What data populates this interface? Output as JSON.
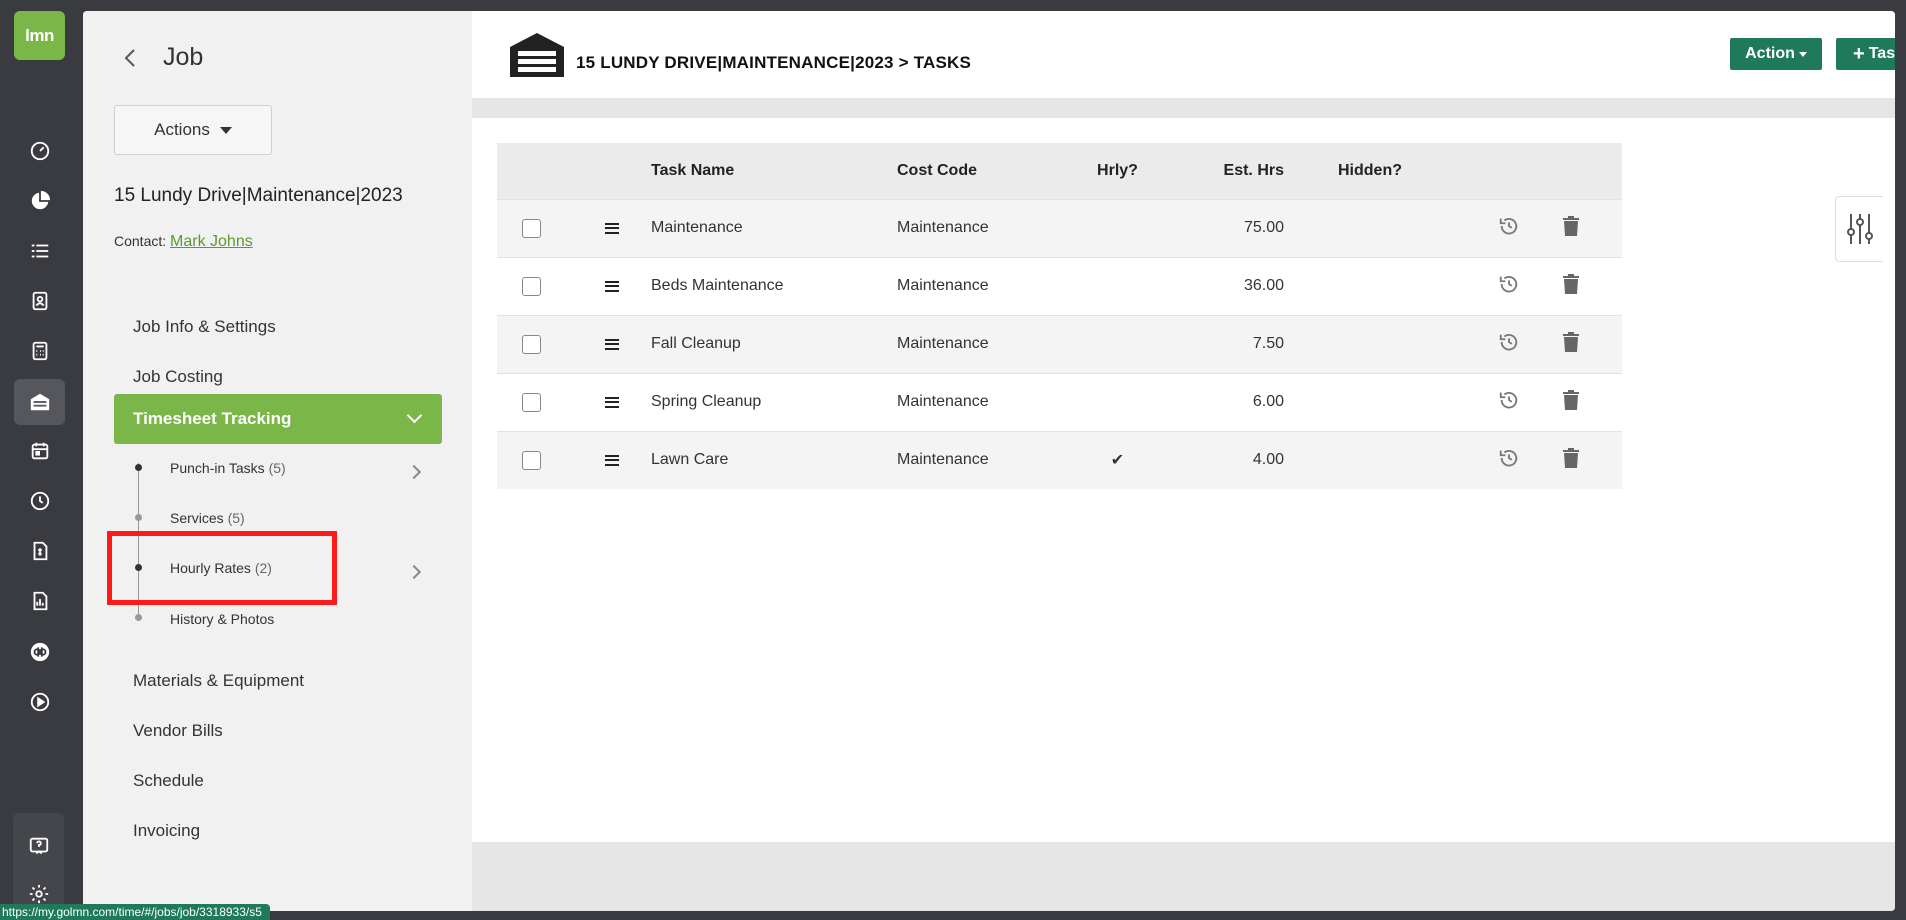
{
  "rail": {
    "logo_text": "lmn",
    "icons": [
      "dashboard-icon",
      "pie-chart-icon",
      "list-icon",
      "contacts-icon",
      "calculator-icon",
      "jobs-icon",
      "calendar-icon",
      "clock-icon",
      "invoice-icon",
      "report-icon",
      "quickbooks-icon",
      "play-icon",
      "help-icon",
      "settings-icon"
    ]
  },
  "sidebar": {
    "title": "Job",
    "actions_label": "Actions",
    "job_name": "15 Lundy Drive|Maintenance|2023",
    "contact_label": "Contact:",
    "contact_name": "Mark Johns",
    "nav": {
      "job_info": "Job Info & Settings",
      "job_costing": "Job Costing",
      "timesheet": "Timesheet Tracking",
      "materials": "Materials & Equipment",
      "vendor_bills": "Vendor Bills",
      "schedule": "Schedule",
      "invoicing": "Invoicing"
    },
    "sub": {
      "punch_label": "Punch-in Tasks",
      "punch_count": "(5)",
      "services_label": "Services",
      "services_count": "(5)",
      "hourly_label": "Hourly Rates",
      "hourly_count": "(2)",
      "history_label": "History & Photos"
    }
  },
  "header": {
    "breadcrumb": "15 LUNDY DRIVE|MAINTENANCE|2023 > TASKS",
    "action_label": "Action",
    "task_label": "Task"
  },
  "table": {
    "headers": {
      "name": "Task Name",
      "cost": "Cost Code",
      "hrly": "Hrly?",
      "hrs": "Est. Hrs",
      "hidden": "Hidden?"
    },
    "rows": [
      {
        "name": "Maintenance",
        "cost": "Maintenance",
        "hrly": "",
        "hrs": "75.00"
      },
      {
        "name": "Beds Maintenance",
        "cost": "Maintenance",
        "hrly": "",
        "hrs": "36.00"
      },
      {
        "name": "Fall Cleanup",
        "cost": "Maintenance",
        "hrly": "",
        "hrs": "7.50"
      },
      {
        "name": "Spring Cleanup",
        "cost": "Maintenance",
        "hrly": "",
        "hrs": "6.00"
      },
      {
        "name": "Lawn Care",
        "cost": "Maintenance",
        "hrly": "✔",
        "hrs": "4.00"
      }
    ]
  },
  "status_url": "https://my.golmn.com/time/#/jobs/job/3318933/s5"
}
